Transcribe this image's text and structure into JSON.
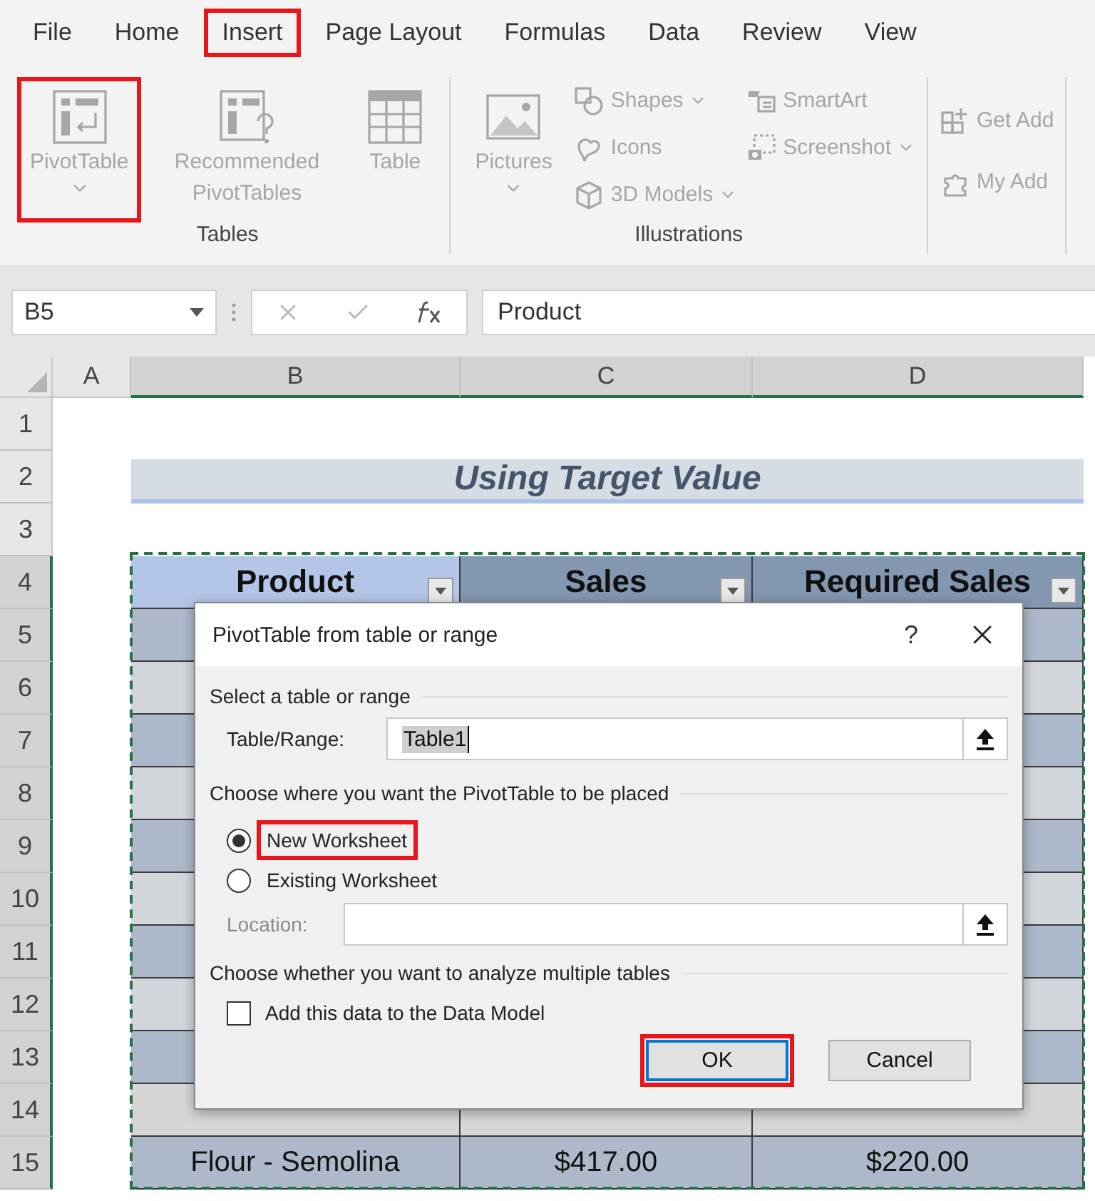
{
  "ribbon_tabs": [
    {
      "label": "File",
      "highlighted": false
    },
    {
      "label": "Home",
      "highlighted": false
    },
    {
      "label": "Insert",
      "highlighted": true
    },
    {
      "label": "Page Layout",
      "highlighted": false
    },
    {
      "label": "Formulas",
      "highlighted": false
    },
    {
      "label": "Data",
      "highlighted": false
    },
    {
      "label": "Review",
      "highlighted": false
    },
    {
      "label": "View",
      "highlighted": false
    }
  ],
  "ribbon_groups": [
    {
      "label": "Tables",
      "columns": [
        {
          "kind": "large",
          "items": [
            {
              "label": "PivotTable",
              "has_menu": true,
              "highlighted": true,
              "disabled": true
            }
          ]
        },
        {
          "kind": "large",
          "items": [
            {
              "label": "Recommended PivotTables",
              "has_menu": false,
              "highlighted": false,
              "disabled": true
            }
          ]
        },
        {
          "kind": "large",
          "items": [
            {
              "label": "Table",
              "has_menu": false,
              "highlighted": false,
              "disabled": true
            }
          ]
        }
      ]
    },
    {
      "label": "Illustrations",
      "columns": [
        {
          "kind": "large",
          "items": [
            {
              "label": "Pictures",
              "has_menu": true,
              "highlighted": false,
              "disabled": true
            }
          ]
        },
        {
          "kind": "small",
          "items": [
            {
              "label": "Shapes",
              "has_menu": true,
              "disabled": true
            },
            {
              "label": "Icons",
              "has_menu": false,
              "disabled": true
            },
            {
              "label": "3D Models",
              "has_menu": true,
              "disabled": true
            }
          ]
        },
        {
          "kind": "small",
          "items": [
            {
              "label": "SmartArt",
              "has_menu": false,
              "disabled": true
            },
            {
              "label": "Screenshot",
              "has_menu": true,
              "disabled": true
            }
          ]
        }
      ]
    },
    {
      "columns": [
        {
          "kind": "medium",
          "items": [
            {
              "label": "Get Add",
              "has_menu": false,
              "disabled": true
            },
            {
              "label": "My Add",
              "has_menu": false,
              "disabled": true
            }
          ]
        }
      ]
    }
  ],
  "formula_bar": {
    "name_box": "B5",
    "formula": "Product"
  },
  "sheet": {
    "columns": [
      {
        "label": "A",
        "selected": false
      },
      {
        "label": "B",
        "selected": true
      },
      {
        "label": "C",
        "selected": true
      },
      {
        "label": "D",
        "selected": true
      }
    ],
    "rows": [
      {
        "label": "1",
        "selected": false,
        "kind": "blank"
      },
      {
        "label": "2",
        "selected": false,
        "kind": "title",
        "title": "Using Target Value"
      },
      {
        "label": "3",
        "selected": false,
        "kind": "blank"
      },
      {
        "label": "4",
        "selected": true,
        "kind": "header",
        "cells": [
          {
            "text": "Product",
            "color": "#b4c6e7"
          },
          {
            "text": "Sales",
            "color": "#8497b0"
          },
          {
            "text": "Required Sales",
            "color": "#8497b0"
          }
        ]
      },
      {
        "label": "5",
        "selected": true,
        "kind": "covered",
        "color": "#adb9ca"
      },
      {
        "label": "6",
        "selected": true,
        "kind": "covered",
        "color": "#d2d5d9"
      },
      {
        "label": "7",
        "selected": true,
        "kind": "covered",
        "color": "#adb9ca"
      },
      {
        "label": "8",
        "selected": true,
        "kind": "covered",
        "color": "#d2d5d9"
      },
      {
        "label": "9",
        "selected": true,
        "kind": "covered",
        "color": "#adb9ca"
      },
      {
        "label": "10",
        "selected": true,
        "kind": "covered",
        "color": "#d2d5d9"
      },
      {
        "label": "11",
        "selected": true,
        "kind": "covered",
        "color": "#adb9ca"
      },
      {
        "label": "12",
        "selected": true,
        "kind": "covered",
        "color": "#d2d5d9"
      },
      {
        "label": "13",
        "selected": true,
        "kind": "covered",
        "color": "#adb9ca"
      },
      {
        "label": "14",
        "selected": true,
        "kind": "data",
        "color": "#d6d6d6"
      },
      {
        "label": "15",
        "selected": true,
        "kind": "data",
        "color": "#adb9ca",
        "cells": [
          "Flour - Semolina",
          "$417.00",
          "$220.00"
        ]
      }
    ]
  },
  "dialog": {
    "title": "PivotTable from table or range",
    "help": "?",
    "range_heading": "Select a table or range",
    "range_label": "Table/Range:",
    "range_value": "Table1",
    "placement_heading": "Choose where you want the PivotTable to be placed",
    "placement_options": [
      {
        "label": "New Worksheet",
        "selected": true,
        "highlighted": true
      },
      {
        "label": "Existing Worksheet",
        "selected": false,
        "highlighted": false
      }
    ],
    "location_label": "Location:",
    "location_disabled": true,
    "multiple_heading": "Choose whether you want to analyze multiple tables",
    "data_model": {
      "label": "Add this data to the Data Model",
      "checked": false
    },
    "buttons": [
      {
        "label": "OK",
        "default": true,
        "highlighted": true
      },
      {
        "label": "Cancel",
        "default": false,
        "highlighted": false
      }
    ]
  }
}
